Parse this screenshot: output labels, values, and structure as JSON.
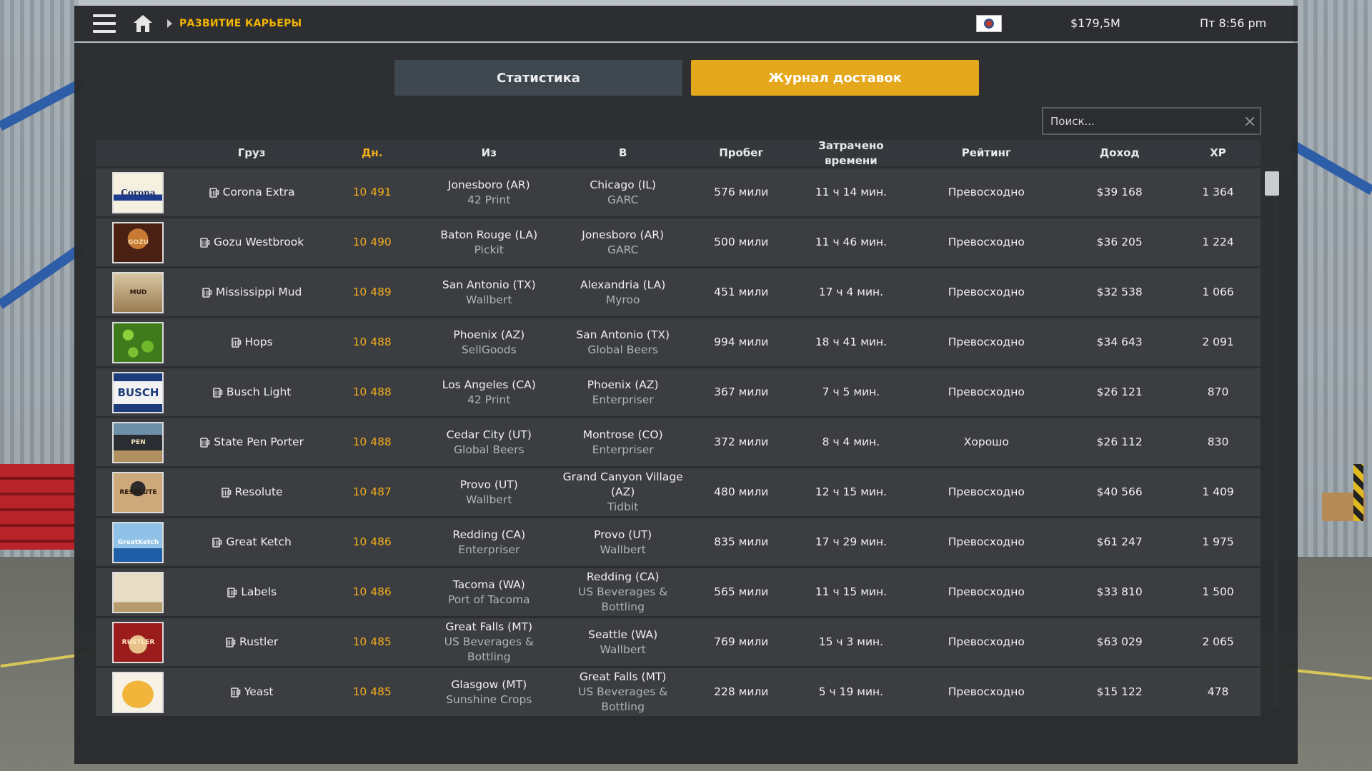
{
  "topbar": {
    "breadcrumb": "РАЗВИТИЕ КАРЬЕРЫ",
    "money": "$179,5M",
    "clock": "Пт 8:56 pm"
  },
  "tabs": {
    "stats": "Статистика",
    "log": "Журнал доставок"
  },
  "search": {
    "placeholder": "Поиск..."
  },
  "table": {
    "headers": {
      "cargo": "Груз",
      "day": "Дн.",
      "from": "Из",
      "to": "В",
      "distance": "Пробег",
      "time": "Затрачено времени",
      "rating": "Рейтинг",
      "income": "Доход",
      "xp": "XP"
    },
    "rows": [
      {
        "thumb": "Corona",
        "cargo": "Corona Extra",
        "day": "10 491",
        "from_city": "Jonesboro (AR)",
        "from_company": "42 Print",
        "to_city": "Chicago (IL)",
        "to_company": "GARC",
        "distance": "576 мили",
        "time": "11 ч 14 мин.",
        "rating": "Превосходно",
        "income": "$39 168",
        "xp": "1 364"
      },
      {
        "thumb": "GOZU",
        "cargo": "Gozu Westbrook",
        "day": "10 490",
        "from_city": "Baton Rouge (LA)",
        "from_company": "Pickit",
        "to_city": "Jonesboro (AR)",
        "to_company": "GARC",
        "distance": "500 мили",
        "time": "11 ч 46 мин.",
        "rating": "Превосходно",
        "income": "$36 205",
        "xp": "1 224"
      },
      {
        "thumb": "MUD",
        "cargo": "Mississippi Mud",
        "day": "10 489",
        "from_city": "San Antonio (TX)",
        "from_company": "Wallbert",
        "to_city": "Alexandria (LA)",
        "to_company": "Myroo",
        "distance": "451 мили",
        "time": "17 ч 4 мин.",
        "rating": "Превосходно",
        "income": "$32 538",
        "xp": "1 066"
      },
      {
        "thumb": "",
        "cargo": "Hops",
        "day": "10 488",
        "from_city": "Phoenix (AZ)",
        "from_company": "SellGoods",
        "to_city": "San Antonio (TX)",
        "to_company": "Global Beers",
        "distance": "994 мили",
        "time": "18 ч 41 мин.",
        "rating": "Превосходно",
        "income": "$34 643",
        "xp": "2 091"
      },
      {
        "thumb": "BUSCH",
        "cargo": "Busch Light",
        "day": "10 488",
        "from_city": "Los Angeles (CA)",
        "from_company": "42 Print",
        "to_city": "Phoenix (AZ)",
        "to_company": "Enterpriser",
        "distance": "367 мили",
        "time": "7 ч 5 мин.",
        "rating": "Превосходно",
        "income": "$26 121",
        "xp": "870"
      },
      {
        "thumb": "PEN",
        "cargo": "State Pen Porter",
        "day": "10 488",
        "from_city": "Cedar City (UT)",
        "from_company": "Global Beers",
        "to_city": "Montrose (CO)",
        "to_company": "Enterpriser",
        "distance": "372 мили",
        "time": "8 ч 4 мин.",
        "rating": "Хорошо",
        "income": "$26 112",
        "xp": "830"
      },
      {
        "thumb": "RESOLUTE",
        "cargo": "Resolute",
        "day": "10 487",
        "from_city": "Provo (UT)",
        "from_company": "Wallbert",
        "to_city": "Grand Canyon Village (AZ)",
        "to_company": "Tidbit",
        "distance": "480 мили",
        "time": "12 ч 15 мин.",
        "rating": "Превосходно",
        "income": "$40 566",
        "xp": "1 409"
      },
      {
        "thumb": "GreatKetch",
        "cargo": "Great Ketch",
        "day": "10 486",
        "from_city": "Redding (CA)",
        "from_company": "Enterpriser",
        "to_city": "Provo (UT)",
        "to_company": "Wallbert",
        "distance": "835 мили",
        "time": "17 ч 29 мин.",
        "rating": "Превосходно",
        "income": "$61 247",
        "xp": "1 975"
      },
      {
        "thumb": "",
        "cargo": "Labels",
        "day": "10 486",
        "from_city": "Tacoma (WA)",
        "from_company": "Port of Tacoma",
        "to_city": "Redding (CA)",
        "to_company": "US Beverages & Bottling",
        "distance": "565 мили",
        "time": "11 ч 15 мин.",
        "rating": "Превосходно",
        "income": "$33 810",
        "xp": "1 500"
      },
      {
        "thumb": "RUSTLER",
        "cargo": "Rustler",
        "day": "10 485",
        "from_city": "Great Falls (MT)",
        "from_company": "US Beverages & Bottling",
        "to_city": "Seattle (WA)",
        "to_company": "Wallbert",
        "distance": "769 мили",
        "time": "15 ч 3 мин.",
        "rating": "Превосходно",
        "income": "$63 029",
        "xp": "2 065"
      },
      {
        "thumb": "",
        "cargo": "Yeast",
        "day": "10 485",
        "from_city": "Glasgow (MT)",
        "from_company": "Sunshine Crops",
        "to_city": "Great Falls (MT)",
        "to_company": "US Beverages & Bottling",
        "distance": "228 мили",
        "time": "5 ч 19 мин.",
        "rating": "Превосходно",
        "income": "$15 122",
        "xp": "478"
      }
    ]
  },
  "icons": {
    "menu": "hamburger-menu-icon",
    "home": "home-icon",
    "cargo": "beer-mug-icon",
    "clear": "close-icon"
  },
  "colors": {
    "accent": "#e5a81c",
    "breadcrumb": "#f2b400",
    "day": "#f4ae1c"
  }
}
